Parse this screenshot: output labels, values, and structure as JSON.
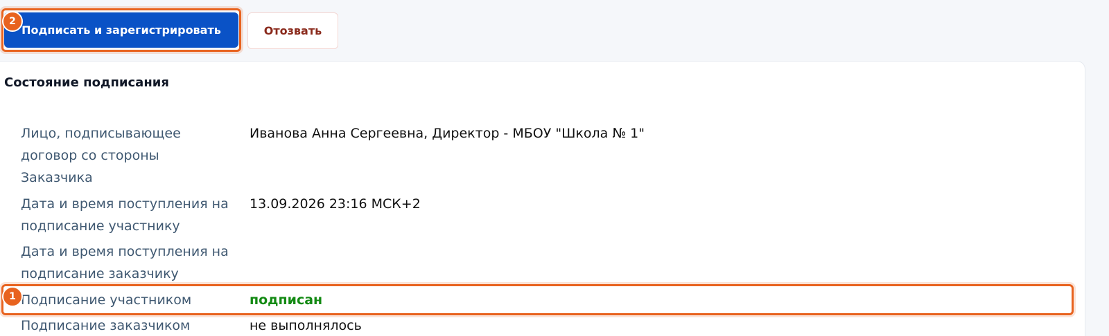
{
  "toolbar": {
    "sign_register_label": "Подписать и зарегистрировать",
    "revoke_label": "Отозвать",
    "badge_sign": "2"
  },
  "panel": {
    "title": "Состояние подписания",
    "badge_row": "1",
    "rows": [
      {
        "label": "Лицо, подписывающее договор со стороны Заказчика",
        "value": "Иванова Анна Сергеевна, Директор - МБОУ \"Школа № 1\""
      },
      {
        "label": "Дата и время поступления на подписание участнику",
        "value": "13.09.2026 23:16 МСК+2"
      },
      {
        "label": "Дата и время поступления на подписание заказчику",
        "value": ""
      },
      {
        "label": "Подписание участником",
        "value": "подписан"
      },
      {
        "label": "Подписание заказчиком",
        "value": "не выполнялось"
      }
    ]
  },
  "colors": {
    "primary": "#0a52c6",
    "highlight": "#e8631f",
    "signed": "#138a13",
    "label": "#3f5871",
    "revoke_text": "#8a2a1c"
  }
}
